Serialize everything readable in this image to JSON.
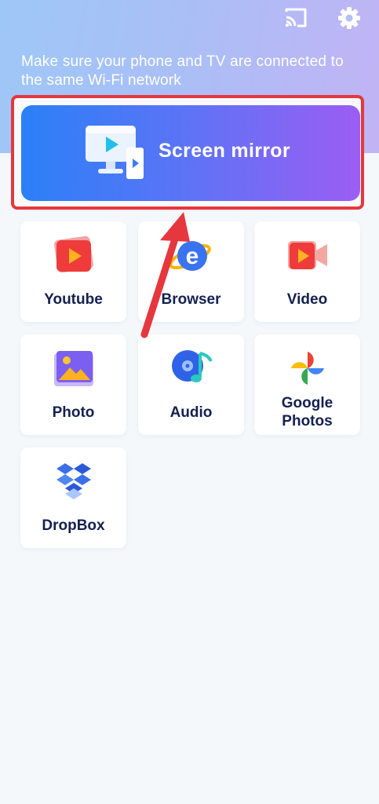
{
  "header": {
    "cast_icon": "cast-icon",
    "settings_icon": "gear-icon",
    "notice": "Make sure your phone and TV are connected to the same Wi-Fi network"
  },
  "mirror": {
    "label": "Screen mirror",
    "icon": "screen-mirror-icon"
  },
  "tiles": [
    {
      "label": "Youtube",
      "icon": "youtube-icon"
    },
    {
      "label": "Browser",
      "icon": "browser-icon"
    },
    {
      "label": "Video",
      "icon": "video-icon"
    },
    {
      "label": "Photo",
      "icon": "photo-icon"
    },
    {
      "label": "Audio",
      "icon": "audio-icon"
    },
    {
      "label": "Google Photos",
      "icon": "google-photos-icon"
    },
    {
      "label": "DropBox",
      "icon": "dropbox-icon"
    }
  ],
  "colors": {
    "accent_blue": "#2b80f7",
    "accent_purple": "#9c5df3",
    "highlight_red": "#e5373d",
    "label_navy": "#142050"
  }
}
